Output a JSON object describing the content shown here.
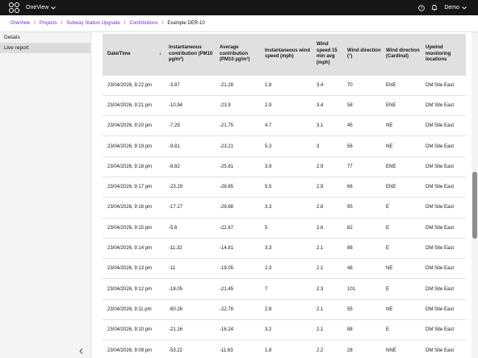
{
  "app": {
    "name": "OneView"
  },
  "header": {
    "help_icon": "help-icon",
    "bell_icon": "notification-bell-icon",
    "user_name": "Demo"
  },
  "breadcrumb": {
    "items": [
      "OneView",
      "Projects",
      "Subway Station Upgrade",
      "Contributions"
    ],
    "current": "Example DER-10"
  },
  "sidebar": {
    "items": [
      "Details",
      "Live report"
    ],
    "active": "Live report",
    "collapse_icon": "chevron-left-icon"
  },
  "table": {
    "columns": [
      "Date/Time",
      "Instantaneous contribution (PM10 µg/m³)",
      "Average contribution (PM10 µg/m³)",
      "Instantaneous wind speed (mph)",
      "Wind speed 15 min avg (mph)",
      "Wind direction (°)",
      "Wind direction (Cardinal)",
      "Upwind monitoring locations"
    ],
    "sort_icon": "sort-down-arrow-icon",
    "rows": [
      [
        "23/04/2026, 9:22 pm",
        "-3.87",
        "-21.28",
        "1.8",
        "3.4",
        "70",
        "ENE",
        "DM Site East"
      ],
      [
        "23/04/2026, 9:21 pm",
        "-10.94",
        "-23.9",
        "2.9",
        "3.4",
        "58",
        "ENE",
        "DM Site East"
      ],
      [
        "23/04/2026, 9:20 pm",
        "-7.29",
        "-21.75",
        "4.7",
        "3.1",
        "45",
        "NE",
        "DM Site East"
      ],
      [
        "23/04/2026, 9:19 pm",
        "-9.81",
        "-23.21",
        "5.3",
        "3",
        "56",
        "NE",
        "DM Site East"
      ],
      [
        "23/04/2026, 9:18 pm",
        "-8.82",
        "-25.81",
        "3.9",
        "2.9",
        "77",
        "ENE",
        "DM Site East"
      ],
      [
        "23/04/2026, 9:17 pm",
        "-23.29",
        "-28.65",
        "5.5",
        "2.9",
        "66",
        "ENE",
        "DM Site East"
      ],
      [
        "23/04/2026, 9:16 pm",
        "-17.17",
        "-29.68",
        "3.3",
        "2.8",
        "95",
        "E",
        "DM Site East"
      ],
      [
        "23/04/2026, 9:15 pm",
        "-5.6",
        "-22.67",
        "5",
        "2.6",
        "82",
        "E",
        "DM Site East"
      ],
      [
        "23/04/2026, 9:14 pm",
        "-11.32",
        "-14.81",
        "3.3",
        "2.1",
        "88",
        "E",
        "DM Site East"
      ],
      [
        "23/04/2026, 9:13 pm",
        "-11",
        "-19.05",
        "2.3",
        "2.1",
        "48",
        "NE",
        "DM Site East"
      ],
      [
        "23/04/2026, 9:12 pm",
        "-18.05",
        "-21.45",
        "7",
        "2.3",
        "101",
        "E",
        "DM Site East"
      ],
      [
        "23/04/2026, 9:11 pm",
        "-60.26",
        "-22.78",
        "2.8",
        "2.1",
        "55",
        "NE",
        "DM Site East"
      ],
      [
        "23/04/2026, 9:10 pm",
        "-21.16",
        "-16.24",
        "3.2",
        "2.1",
        "88",
        "E",
        "DM Site East"
      ],
      [
        "23/04/2026, 9:09 pm",
        "-53.22",
        "-11.63",
        "1.8",
        "2.2",
        "28",
        "NNE",
        "DM Site East"
      ]
    ]
  }
}
